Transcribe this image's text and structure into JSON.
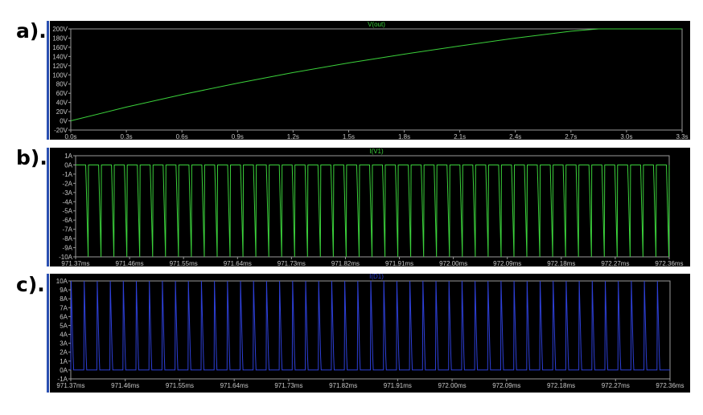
{
  "panel_labels": [
    "a).",
    "b).",
    "c)."
  ],
  "chart_data": [
    {
      "type": "line",
      "title": "V(out)",
      "series": [
        {
          "name": "V(out)",
          "color": "#3bd13b",
          "x": [
            0.0,
            0.3,
            0.6,
            0.9,
            1.2,
            1.5,
            1.8,
            2.1,
            2.4,
            2.7,
            2.85,
            3.0,
            3.3
          ],
          "y": [
            0,
            30,
            57,
            82,
            105,
            126,
            145,
            163,
            180,
            195,
            200,
            200,
            200
          ]
        }
      ],
      "x_ticks": [
        "0.0s",
        "0.3s",
        "0.6s",
        "0.9s",
        "1.2s",
        "1.5s",
        "1.8s",
        "2.1s",
        "2.4s",
        "2.7s",
        "3.0s",
        "3.3s"
      ],
      "y_ticks": [
        "-20V",
        "0V",
        "20V",
        "40V",
        "60V",
        "80V",
        "100V",
        "120V",
        "140V",
        "160V",
        "180V",
        "200V"
      ],
      "xlim": [
        0,
        3.3
      ],
      "ylim": [
        -20,
        200
      ],
      "grid": false
    },
    {
      "type": "line",
      "title": "I(V1)",
      "series": [
        {
          "name": "I(V1)",
          "color": "#3bd13b",
          "pulse_count": 46,
          "high": 0,
          "low": -10,
          "pulse_shape": "negative-ramp"
        }
      ],
      "x_ticks": [
        "971.37ms",
        "971.46ms",
        "971.55ms",
        "971.64ms",
        "971.73ms",
        "971.82ms",
        "971.91ms",
        "972.00ms",
        "972.09ms",
        "972.18ms",
        "972.27ms",
        "972.36ms"
      ],
      "y_ticks": [
        "-10A",
        "-9A",
        "-8A",
        "-7A",
        "-6A",
        "-5A",
        "-4A",
        "-3A",
        "-2A",
        "-1A",
        "0A",
        "1A"
      ],
      "xlim": [
        971.37,
        972.36
      ],
      "ylim": [
        -10,
        1
      ],
      "grid": false
    },
    {
      "type": "line",
      "title": "I(D1)",
      "series": [
        {
          "name": "I(D1)",
          "color": "#2d3fd6",
          "pulse_count": 46,
          "high": 10,
          "low": 0,
          "pulse_shape": "positive-spike"
        }
      ],
      "x_ticks": [
        "971.37ms",
        "971.46ms",
        "971.55ms",
        "971.64ms",
        "971.73ms",
        "971.82ms",
        "971.91ms",
        "972.00ms",
        "972.09ms",
        "972.18ms",
        "972.27ms",
        "972.36ms"
      ],
      "y_ticks": [
        "-1A",
        "0A",
        "1A",
        "2A",
        "3A",
        "4A",
        "5A",
        "6A",
        "7A",
        "8A",
        "9A",
        "10A"
      ],
      "xlim": [
        971.37,
        972.36
      ],
      "ylim": [
        -1,
        10
      ],
      "grid": false
    }
  ]
}
